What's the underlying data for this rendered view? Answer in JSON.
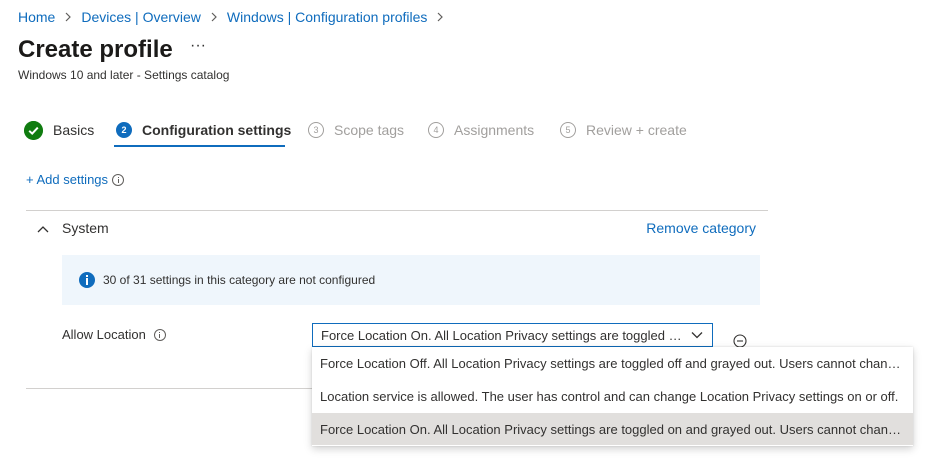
{
  "breadcrumb": {
    "items": [
      "Home",
      "Devices | Overview",
      "Windows | Configuration profiles"
    ]
  },
  "header": {
    "title": "Create profile",
    "more_label": "···",
    "subtitle": "Windows 10 and later - Settings catalog"
  },
  "wizard": {
    "steps": [
      {
        "number": "",
        "label": "Basics",
        "state": "completed"
      },
      {
        "number": "2",
        "label": "Configuration settings",
        "state": "current"
      },
      {
        "number": "3",
        "label": "Scope tags",
        "state": "upcoming"
      },
      {
        "number": "4",
        "label": "Assignments",
        "state": "upcoming"
      },
      {
        "number": "5",
        "label": "Review + create",
        "state": "upcoming"
      }
    ]
  },
  "add_settings": {
    "label": "+ Add settings"
  },
  "category": {
    "name": "System",
    "remove_label": "Remove category",
    "banner": "30 of 31 settings in this category are not configured"
  },
  "setting": {
    "label": "Allow Location",
    "selected_value": "Force Location On. All Location Privacy settings are toggled on and grayed out. Users cannot change the settings and all consent permissions will be automatically suppressed.",
    "options": [
      {
        "label": "Force Location Off. All Location Privacy settings are toggled off and grayed out. Users cannot change the settings, and no apps are allowed access to the Location service, including Cortana and Search.",
        "selected": false
      },
      {
        "label": "Location service is allowed. The user has control and can change Location Privacy settings on or off.",
        "selected": false
      },
      {
        "label": "Force Location On. All Location Privacy settings are toggled on and grayed out. Users cannot change the settings and all consent permissions will be automatically suppressed.",
        "selected": true
      }
    ]
  },
  "colors": {
    "accent": "#0f6cbd",
    "success": "#107c10",
    "banner_bg": "#eff6fc",
    "selected_option_bg": "#e1dfdd"
  }
}
